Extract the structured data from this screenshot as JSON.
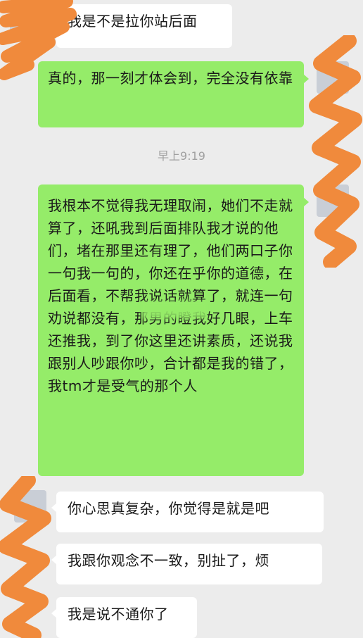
{
  "messages": [
    {
      "side": "in",
      "text": "我是不是拉你站后面"
    },
    {
      "side": "out",
      "text": "真的，那一刻才体会到，完全没有依靠"
    },
    {
      "side": "out",
      "text": "我根本不觉得我无理取闹，她们不走就算了，还吼我到后面排队我才说的他们，堵在那里还有理了，他们两口子你一句我一句的，你还在乎你的道德，在后面看，不帮我说话就算了，就连一句劝说都没有，那男的瞪我好几眼，上车还推我，到了你这里还讲素质，还说我跟别人吵跟你吵，合计都是我的错了，我tm才是受气的那个人"
    },
    {
      "side": "in",
      "text": "你心思真复杂，你觉得是就是吧"
    },
    {
      "side": "in",
      "text": "我跟你观念不一致，别扯了，烦"
    },
    {
      "side": "in",
      "text": "我是说不通你了"
    }
  ],
  "timestamp": "早上9:19",
  "colors": {
    "background": "#ececec",
    "outgoing_bubble": "#95ec69",
    "incoming_bubble": "#ffffff",
    "redaction": "#f08a3c"
  }
}
